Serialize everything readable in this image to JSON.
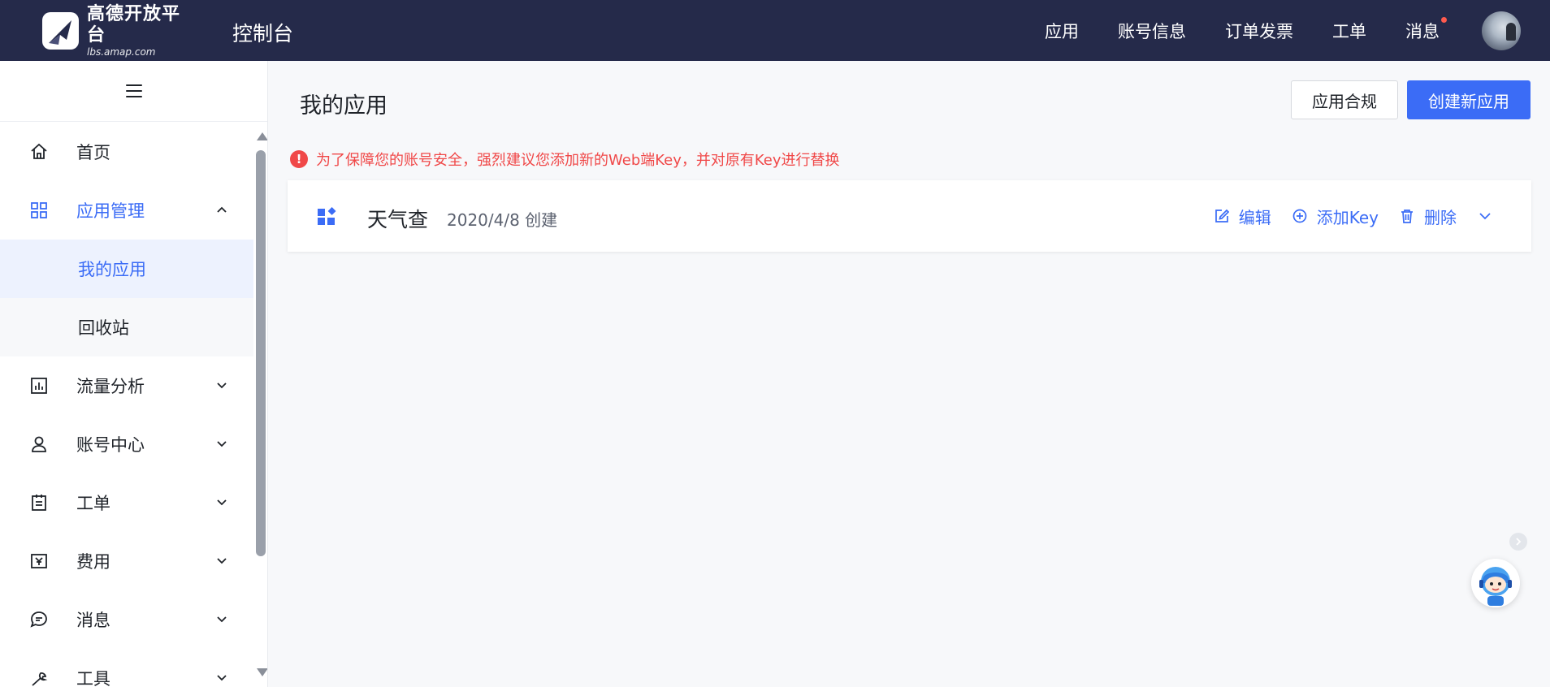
{
  "header": {
    "logo_text": "高德开放平台",
    "logo_sub": "lbs.amap.com",
    "console_title": "控制台",
    "nav": [
      {
        "label": "应用"
      },
      {
        "label": "账号信息"
      },
      {
        "label": "订单发票"
      },
      {
        "label": "工单"
      },
      {
        "label": "消息",
        "has_dot": true
      }
    ]
  },
  "sidebar": {
    "items": [
      {
        "label": "首页",
        "icon": "home-icon"
      },
      {
        "label": "应用管理",
        "icon": "grid-icon",
        "expanded": true,
        "children": [
          {
            "label": "我的应用",
            "active": true
          },
          {
            "label": "回收站"
          }
        ]
      },
      {
        "label": "流量分析",
        "icon": "chart-icon"
      },
      {
        "label": "账号中心",
        "icon": "user-icon"
      },
      {
        "label": "工单",
        "icon": "ticket-icon"
      },
      {
        "label": "费用",
        "icon": "yuan-icon"
      },
      {
        "label": "消息",
        "icon": "message-icon"
      },
      {
        "label": "工具",
        "icon": "wrench-icon"
      }
    ]
  },
  "main": {
    "title": "我的应用",
    "btn_compliance": "应用合规",
    "btn_create": "创建新应用",
    "warning_icon": "!",
    "warning": "为了保障您的账号安全，强烈建议您添加新的Web端Key，并对原有Key进行替换",
    "app": {
      "name": "天气查",
      "date": "2020/4/8 创建",
      "actions": {
        "edit": "编辑",
        "add_key": "添加Key",
        "delete": "删除"
      }
    }
  },
  "colors": {
    "header_bg": "#252a4a",
    "accent": "#3b6cf6",
    "warning": "#f04848"
  }
}
